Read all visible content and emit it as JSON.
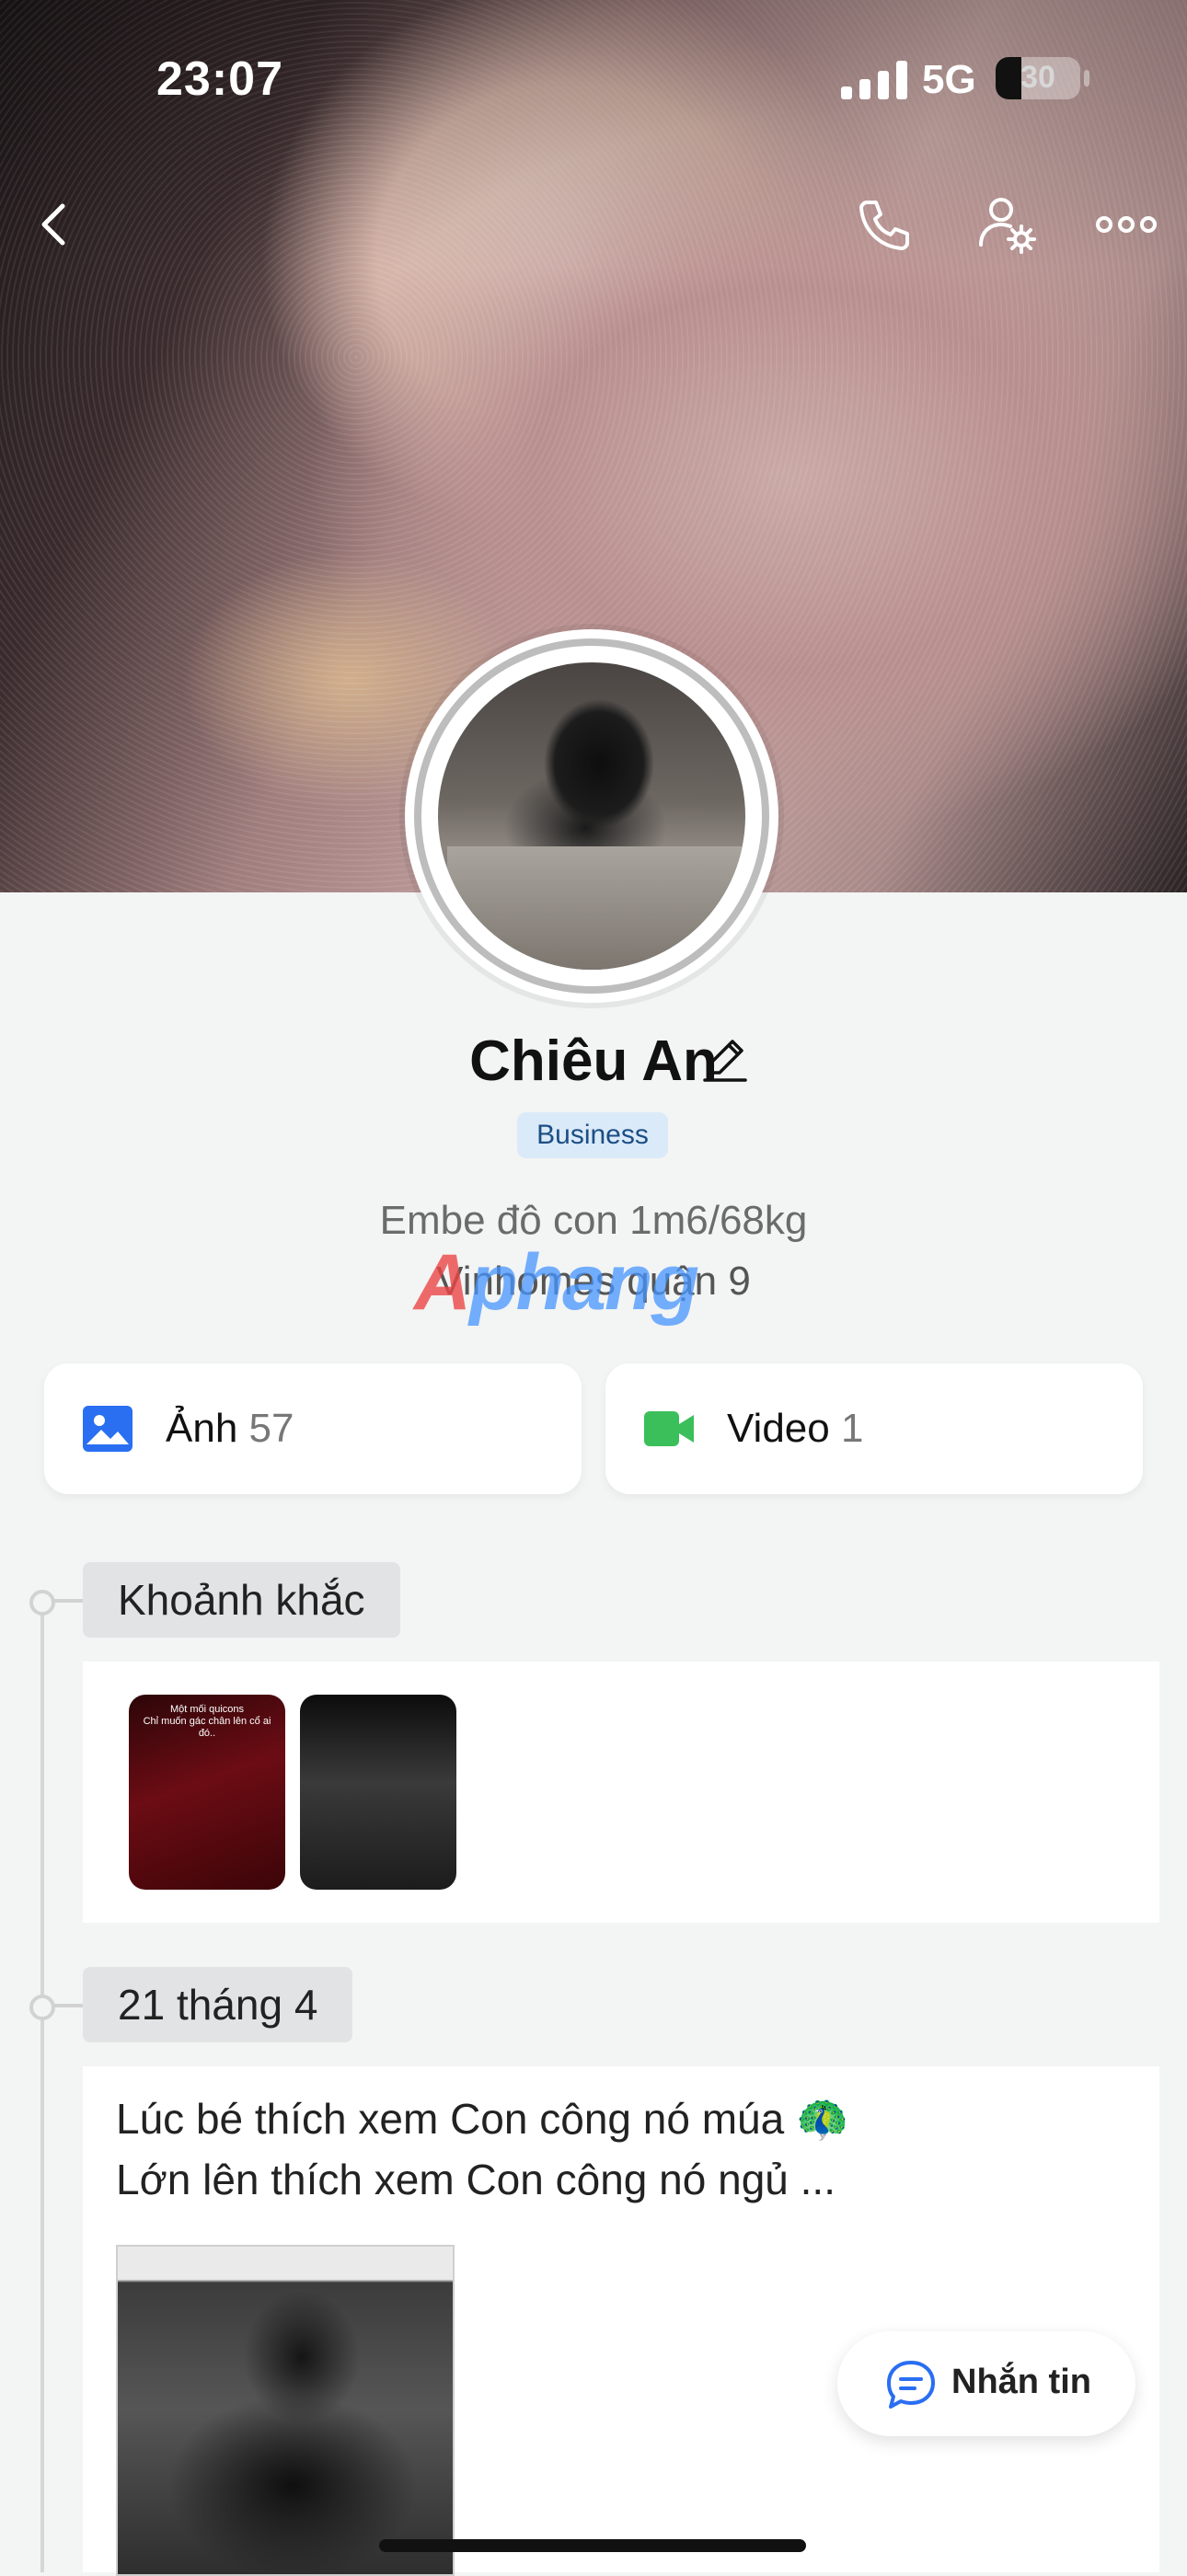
{
  "status_bar": {
    "time": "23:07",
    "network": "5G",
    "battery": "30"
  },
  "profile": {
    "name": "Chiêu An",
    "badge": "Business",
    "bio_line1": "Embe đô con 1m6/68kg",
    "bio_line2": "Vinhomes quận 9",
    "watermark": "Aphang"
  },
  "media_tabs": [
    {
      "label": "Ảnh",
      "count": "57",
      "icon": "image-icon",
      "color": "#2a6ef2"
    },
    {
      "label": "Video",
      "count": "1",
      "icon": "video-icon",
      "color": "#3bbf5a"
    }
  ],
  "timeline": {
    "moments_label": "Khoảnh khắc",
    "stories": [
      {
        "caption": "Một mối quicons\nChỉ muốn gác chân lên cổ ai đó.."
      },
      {
        "caption": ""
      }
    ],
    "date_label": "21 tháng 4",
    "post_line1": "Lúc bé thích xem Con công nó múa 🦚",
    "post_line2": "Lớn lên thích xem Con công nó ngủ ..."
  },
  "message_button": {
    "label": "Nhắn tin"
  },
  "colors": {
    "accent": "#2a6ef2",
    "badge_bg": "#dbeaf8",
    "badge_text": "#1b4e86"
  }
}
